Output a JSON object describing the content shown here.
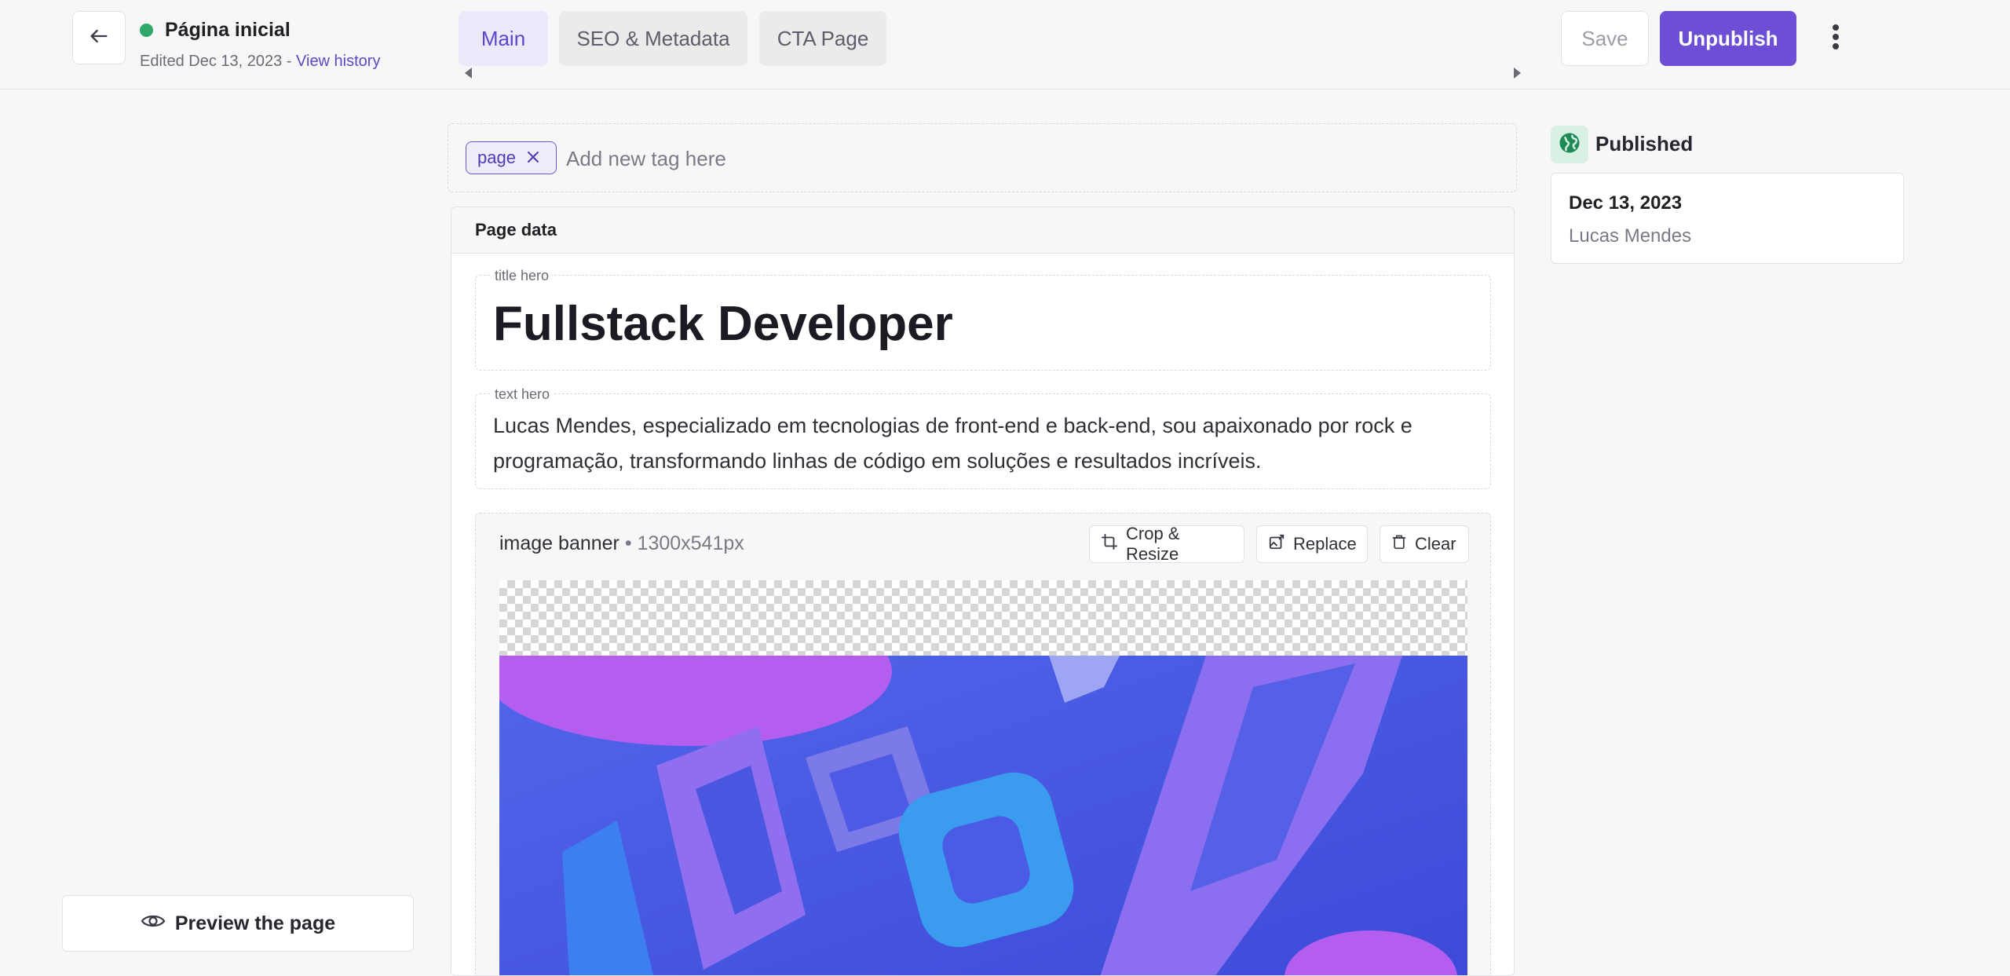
{
  "header": {
    "page_name": "Página inicial",
    "edited_text": "Edited Dec 13, 2023 - ",
    "view_history": "View history",
    "tabs": [
      {
        "label": "Main",
        "active": true
      },
      {
        "label": "SEO & Metadata",
        "active": false
      },
      {
        "label": "CTA Page",
        "active": false
      }
    ],
    "save_label": "Save",
    "unpublish_label": "Unpublish"
  },
  "tags": {
    "items": [
      "page"
    ],
    "placeholder": "Add new tag here"
  },
  "page_data": {
    "heading": "Page data",
    "title_hero": {
      "label": "title hero",
      "value": "Fullstack Developer"
    },
    "text_hero": {
      "label": "text hero",
      "value": "Lucas Mendes, especializado em tecnologias de front-end e back-end, sou apaixonado por rock e programação, transformando linhas de código em soluções e resultados incríveis."
    },
    "image_banner": {
      "label": "image banner",
      "dimensions": " • 1300x541px",
      "crop_label": "Crop & Resize",
      "replace_label": "Replace",
      "clear_label": "Clear"
    }
  },
  "status": {
    "label": "Published",
    "date": "Dec 13, 2023",
    "author": "Lucas Mendes"
  },
  "preview_label": "Preview the page",
  "colors": {
    "accent": "#6d4fd6",
    "status_dot": "#2fa86a",
    "banner_blue": "#4a5be6",
    "banner_purple": "#9a5ce8"
  }
}
